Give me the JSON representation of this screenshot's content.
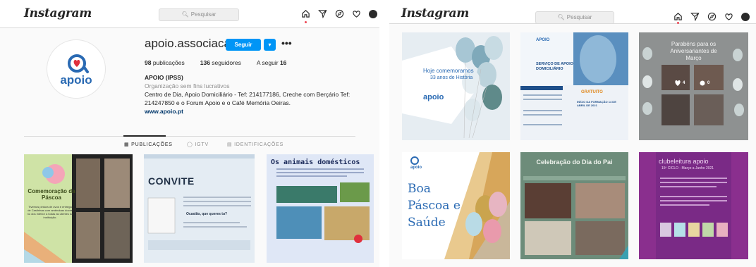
{
  "left": {
    "header": {
      "logo": "Instagram",
      "search_placeholder": "Pesquisar"
    },
    "profile": {
      "username": "apoio.associacao",
      "follow_label": "Seguir",
      "more_label": "•••",
      "avatar_text": "apoio",
      "stats": [
        {
          "count": "98",
          "label": " publicações"
        },
        {
          "count": "136",
          "label": " seguidores"
        },
        {
          "count": "16",
          "label": "A seguir "
        }
      ],
      "bio_name": "APOIO (IPSS)",
      "bio_category": "Organização sem fins lucrativos",
      "bio_text": "Centro de Dia, Apoio Domiciliário - Tef: 214177186, Creche com Berçário Tef: 214247850 e o Forum Apoio e o Café Memória Oeiras.",
      "bio_link": "www.apoio.pt"
    },
    "tabs": [
      {
        "label": "PUBLICAÇÕES",
        "icon": "grid-icon"
      },
      {
        "label": "IGTV",
        "icon": "igtv-icon"
      },
      {
        "label": "IDENTIFICAÇÕES",
        "icon": "tag-icon"
      }
    ],
    "posts": [
      {
        "title": "Comemoração da Páscoa",
        "caption": "Tivemos pintura de ovos e entrega de Castinhas com amêndoas doces no dos interior a todas as utentes da instituição."
      },
      {
        "title": "CONVITE",
        "caption": "Ocasião, que queres tu?"
      },
      {
        "title": "Os animais domésticos"
      }
    ]
  },
  "right": {
    "header": {
      "logo": "Instagram",
      "search_placeholder": "Pesquisar"
    },
    "posts": [
      {
        "title": "Hoje comemoramos",
        "subtitle": "33 anos de História",
        "brand": "apoio"
      },
      {
        "title": "SERVIÇO DE APOIO DOMICILIÁRIO",
        "badge": "GRATUITO",
        "date": "INÍCIO DA FORMAÇÃO 14 DE ABRIL DE 2021",
        "brand": "APOIO"
      },
      {
        "title": "Parabéns para os Aniversariantes de Março",
        "likes": "4",
        "comments": "0"
      },
      {
        "title": "Boa Páscoa e Saúde",
        "brand": "apoio"
      },
      {
        "title": "Celebração do Dia do Pai"
      },
      {
        "title": "clubeleitura apoio",
        "subtitle": "15º CICLO - Março a Junho 2021"
      }
    ]
  },
  "colors": {
    "accent": "#0095f6",
    "brand": "#2a6ab3",
    "brand_red": "#e0303c"
  }
}
